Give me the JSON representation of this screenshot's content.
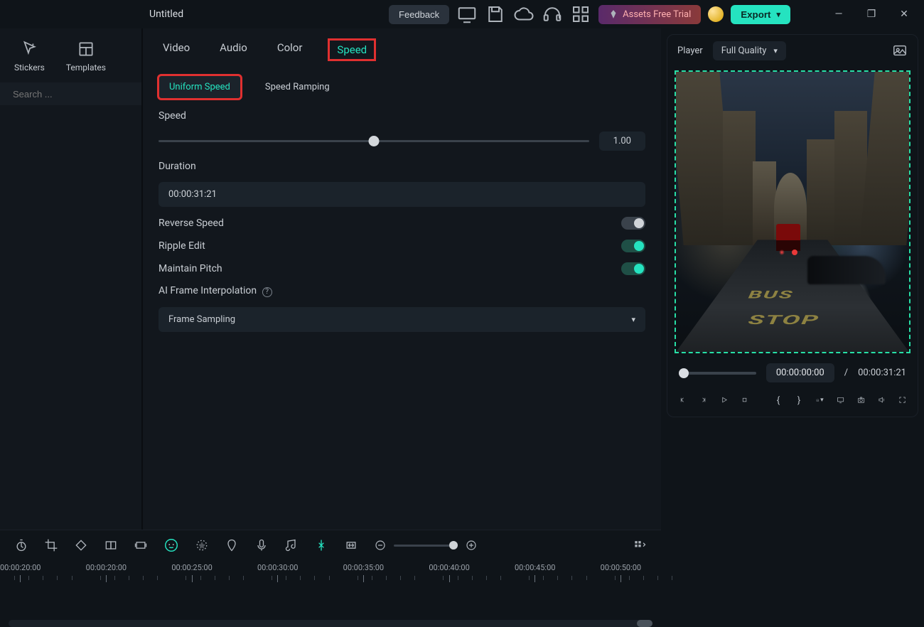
{
  "titlebar": {
    "project_name": "Untitled",
    "feedback": "Feedback",
    "assets_trial": "Assets Free Trial",
    "export": "Export"
  },
  "sidebar": {
    "tabs": {
      "stickers": "Stickers",
      "templates": "Templates"
    },
    "search_placeholder": "Search ..."
  },
  "preview": {
    "player_label": "Player",
    "quality": "Full Quality",
    "road_text_1": "BUS",
    "road_text_2": "STOP",
    "current_time": "00:00:00:00",
    "separator": "/",
    "total_time": "00:00:31:21"
  },
  "inspector": {
    "tabs": {
      "video": "Video",
      "audio": "Audio",
      "color": "Color",
      "speed": "Speed"
    },
    "sub_tabs": {
      "uniform": "Uniform Speed",
      "ramping": "Speed Ramping"
    },
    "speed_label": "Speed",
    "speed_value": "1.00",
    "duration_label": "Duration",
    "duration_value": "00:00:31:21",
    "reverse_label": "Reverse Speed",
    "ripple_label": "Ripple Edit",
    "pitch_label": "Maintain Pitch",
    "ai_label": "AI Frame Interpolation",
    "ai_value": "Frame Sampling"
  },
  "timeline": {
    "ticks": [
      "00:00:20:00",
      "00:00:20:00",
      "00:00:25:00",
      "00:00:30:00",
      "00:00:35:00",
      "00:00:40:00",
      "00:00:45:00",
      "00:00:50:00"
    ]
  }
}
